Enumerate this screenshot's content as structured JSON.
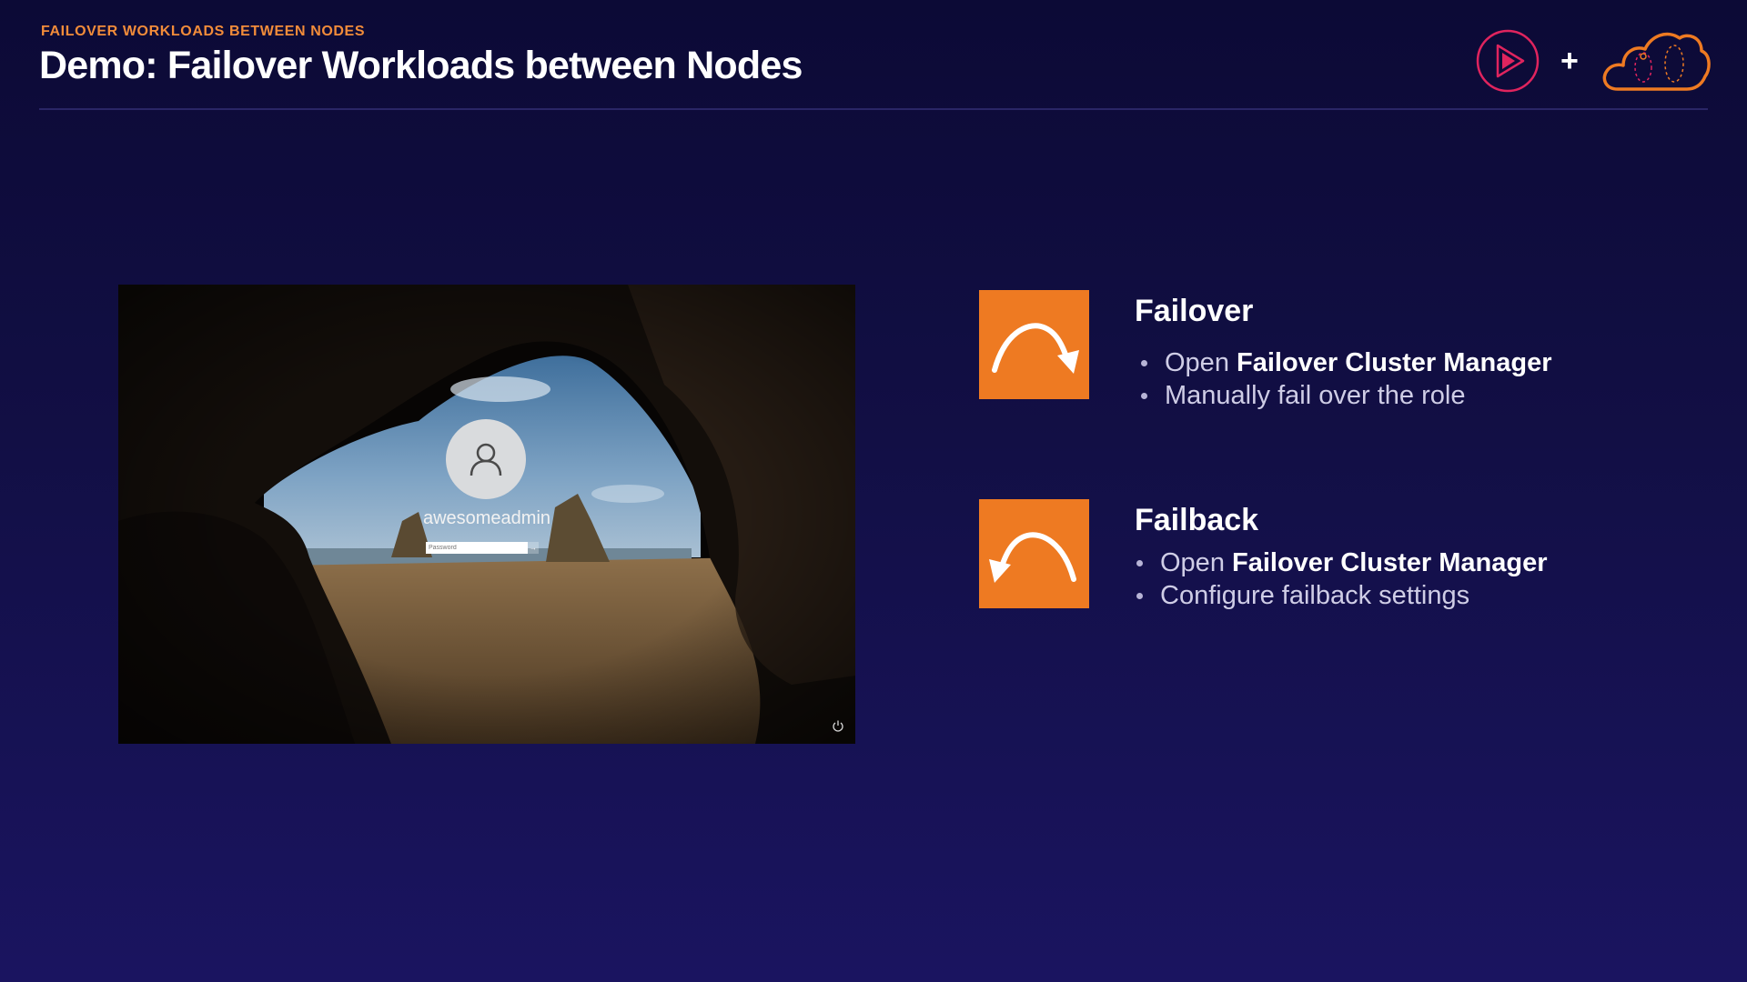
{
  "header": {
    "kicker": "FAILOVER WORKLOADS BETWEEN NODES",
    "title": "Demo: Failover Workloads between Nodes",
    "plus": "+"
  },
  "colors": {
    "accent_orange": "#ee7a22",
    "brand_pink": "#e0245e",
    "background": "#120f45"
  },
  "screenshot": {
    "username": "awesomeadmin",
    "password_placeholder": "Password",
    "submit_icon": "arrow-right-icon",
    "power_icon": "power-icon"
  },
  "items": [
    {
      "icon": "arrow-curve-right-icon",
      "heading": "Failover",
      "bullets": [
        {
          "prefix": "Open ",
          "bold": "Failover Cluster Manager"
        },
        {
          "prefix": "Manually fail over the role",
          "bold": ""
        }
      ]
    },
    {
      "icon": "arrow-curve-left-icon",
      "heading": "Failback",
      "bullets": [
        {
          "prefix": "Open ",
          "bold": "Failover Cluster Manager"
        },
        {
          "prefix": "Configure failback settings",
          "bold": ""
        }
      ]
    }
  ]
}
